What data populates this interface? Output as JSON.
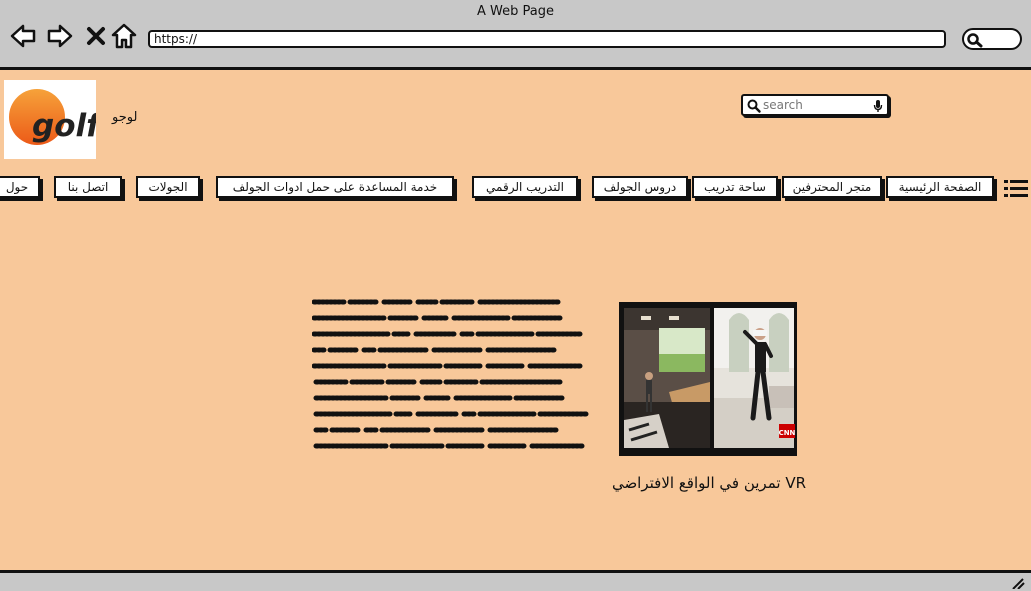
{
  "window": {
    "title": "A Web Page",
    "url": "https://"
  },
  "header": {
    "logo_word": "golf",
    "logo_label": "لوجو",
    "search_placeholder": "search"
  },
  "nav": {
    "items": [
      "الصفحة الرئيسية",
      "متجر المحترفين",
      "ساحة تدريب",
      "دروس الجولف",
      "التدريب الرقمي",
      "خدمة المساعدة على حمل ادوات الجولف",
      "الجولات",
      "اتصل بنا",
      "حول"
    ]
  },
  "main": {
    "video_caption": "VR تمرين في الواقع الافتراضي",
    "cnn_badge": "CNN"
  },
  "colors": {
    "page_bg": "#f8c89a",
    "chrome_bg": "#c8c8c8",
    "logo_orange": "#f07a1a"
  }
}
